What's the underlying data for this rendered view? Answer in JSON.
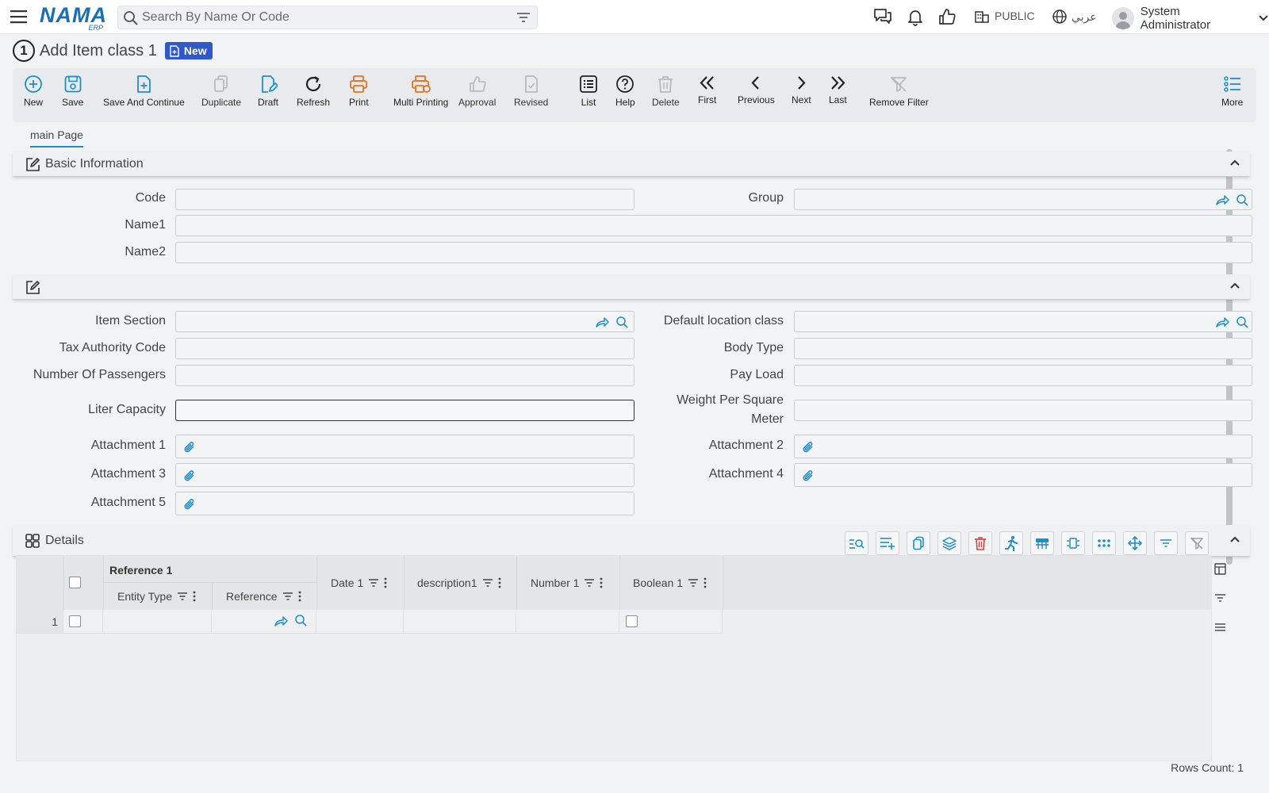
{
  "header": {
    "logo_text": "NAMA",
    "logo_sub": "ERP",
    "search_placeholder": "Search By Name Or Code",
    "public_label": "PUBLIC",
    "language_label": "عربي",
    "user_name": "System Administrator"
  },
  "page": {
    "step_number": "1",
    "title": "Add Item class 1",
    "badge": "New"
  },
  "toolbar": {
    "new": "New",
    "save": "Save",
    "save_continue": "Save And Continue",
    "duplicate": "Duplicate",
    "draft": "Draft",
    "refresh": "Refresh",
    "print": "Print",
    "multi_printing": "Multi Printing",
    "approval": "Approval",
    "revised": "Revised",
    "list": "List",
    "help": "Help",
    "delete": "Delete",
    "first": "First",
    "previous": "Previous",
    "next": "Next",
    "last": "Last",
    "remove_filter": "Remove Filter",
    "more": "More"
  },
  "tabs": {
    "main": "main Page"
  },
  "basic_info": {
    "title": "Basic Information",
    "code_label": "Code",
    "group_label": "Group",
    "name1_label": "Name1",
    "name2_label": "Name2"
  },
  "section2": {
    "item_section": "Item Section",
    "default_location_class": "Default location class",
    "tax_authority_code": "Tax Authority Code",
    "body_type": "Body Type",
    "number_of_passengers": "Number Of Passengers",
    "pay_load": "Pay Load",
    "liter_capacity": "Liter Capacity",
    "weight_per_sqm_line1": "Weight Per Square",
    "weight_per_sqm_line2": "Meter",
    "attachment1": "Attachment 1",
    "attachment2": "Attachment 2",
    "attachment3": "Attachment 3",
    "attachment4": "Attachment 4",
    "attachment5": "Attachment 5"
  },
  "details": {
    "title": "Details",
    "group_header": "Reference 1",
    "columns": {
      "entity_type": "Entity Type",
      "reference": "Reference",
      "date1": "Date 1",
      "description1": "description1",
      "number1": "Number 1",
      "boolean1": "Boolean 1"
    },
    "rows": [
      {
        "index": "1"
      }
    ],
    "rows_count": "Rows Count: 1"
  },
  "colors": {
    "accent_blue": "#1f8fc8",
    "orange": "#e8731f",
    "badge_blue": "#2f59c8",
    "danger_red": "#e0403a"
  }
}
